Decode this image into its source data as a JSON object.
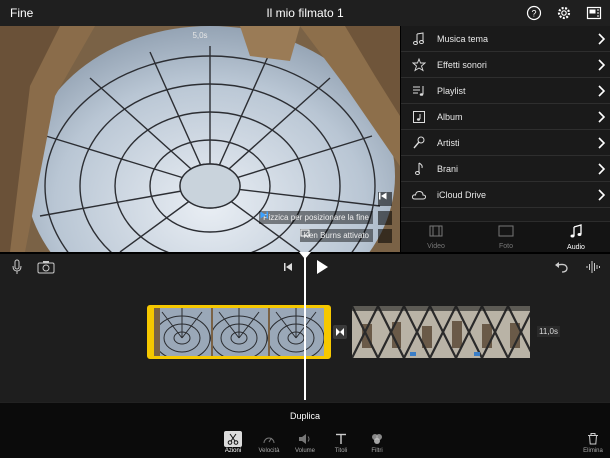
{
  "topbar": {
    "done_label": "Fine",
    "title": "Il mio filmato 1"
  },
  "preview": {
    "timecode": "5,0s",
    "pinch_label": "Pizzica per posizionare la fine",
    "kenburns_label": "Ken Burns attivato"
  },
  "browser": {
    "items": [
      {
        "label": "Musica tema",
        "icon": "music-note-icon"
      },
      {
        "label": "Effetti sonori",
        "icon": "sound-effects-icon"
      },
      {
        "label": "Playlist",
        "icon": "playlist-icon"
      },
      {
        "label": "Album",
        "icon": "album-icon"
      },
      {
        "label": "Artisti",
        "icon": "microphone-icon"
      },
      {
        "label": "Brani",
        "icon": "music-note-icon"
      },
      {
        "label": "iCloud Drive",
        "icon": "cloud-icon"
      }
    ],
    "tabs": [
      {
        "label": "Video",
        "icon": "film-icon"
      },
      {
        "label": "Foto",
        "icon": "photo-icon"
      },
      {
        "label": "Audio",
        "icon": "music-note-icon"
      }
    ],
    "active_tab": "Audio"
  },
  "timeline": {
    "clip2_duration": "11,0s"
  },
  "bottom": {
    "action_title": "Duplica",
    "tools": [
      {
        "label": "Azioni",
        "icon": "scissors-icon",
        "active": true
      },
      {
        "label": "Velocità",
        "icon": "speedometer-icon",
        "active": false
      },
      {
        "label": "Volume",
        "icon": "speaker-icon",
        "active": false
      },
      {
        "label": "Titoli",
        "icon": "text-icon",
        "active": false
      },
      {
        "label": "Filtri",
        "icon": "filters-icon",
        "active": false
      }
    ],
    "delete_label": "Elimina"
  },
  "colors": {
    "accent": "#f6c800",
    "background": "#1e1e1e"
  }
}
